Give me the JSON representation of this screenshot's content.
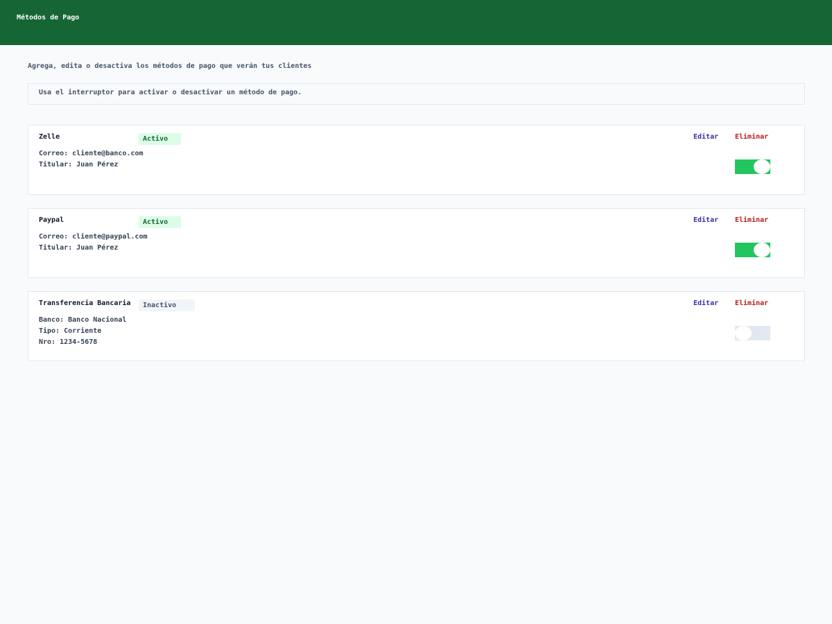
{
  "header": {
    "title": "Métodos de Pago"
  },
  "page": {
    "subtitle": "Agrega, edita o desactiva los métodos de pago que verán tus clientes",
    "info": "Usa el interruptor para activar o desactivar un método de pago."
  },
  "actions": {
    "edit_label": "Editar",
    "delete_label": "Eliminar"
  },
  "methods": [
    {
      "name": "Zelle",
      "status": "Activo",
      "enabled": true,
      "details": [
        "Correo: cliente@banco.com",
        "Titular: Juan Pérez"
      ]
    },
    {
      "name": "Paypal",
      "status": "Activo",
      "enabled": true,
      "details": [
        "Correo: cliente@paypal.com",
        "Titular: Juan Pérez"
      ]
    },
    {
      "name": "Transferencia Bancaria",
      "status": "Inactivo",
      "enabled": false,
      "details": [
        "Banco: Banco Nacional",
        "Tipo: Corriente",
        "Nro: 1234-5678"
      ]
    }
  ],
  "colors": {
    "header": "#166534",
    "active_badge_bg": "#dcfce7",
    "active_badge_text": "#166534",
    "inactive_badge_bg": "#f1f5f9",
    "toggle_on": "#22c55e",
    "toggle_off": "#e2e8f0",
    "edit": "#3730a3",
    "delete": "#b91c1c"
  }
}
